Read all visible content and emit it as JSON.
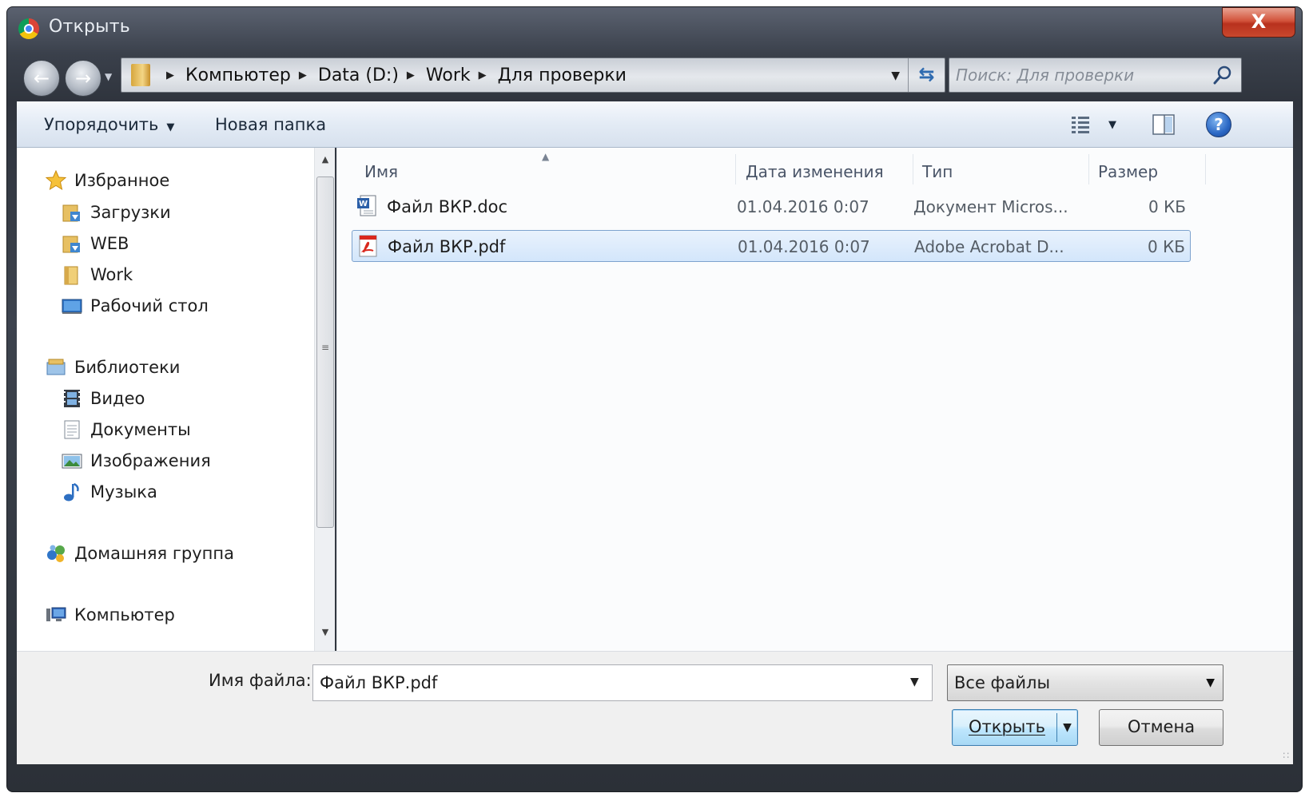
{
  "window": {
    "title": "Открыть",
    "close_glyph": "X"
  },
  "address": {
    "breadcrumb": [
      "Компьютер",
      "Data (D:)",
      "Work",
      "Для проверки"
    ],
    "search_placeholder": "Поиск: Для проверки"
  },
  "toolbar": {
    "organize_label": "Упорядочить",
    "new_folder_label": "Новая папка",
    "help_glyph": "?"
  },
  "nav": {
    "favorites": {
      "label": "Избранное",
      "items": [
        {
          "label": "Загрузки",
          "icon": "downloads-folder-icon"
        },
        {
          "label": "WEB",
          "icon": "downloads-folder-icon"
        },
        {
          "label": "Work",
          "icon": "folder-icon"
        },
        {
          "label": "Рабочий стол",
          "icon": "desktop-icon"
        }
      ]
    },
    "libraries": {
      "label": "Библиотеки",
      "items": [
        {
          "label": "Видео",
          "icon": "video-library-icon"
        },
        {
          "label": "Документы",
          "icon": "documents-library-icon"
        },
        {
          "label": "Изображения",
          "icon": "pictures-library-icon"
        },
        {
          "label": "Музыка",
          "icon": "music-library-icon"
        }
      ]
    },
    "homegroup": {
      "label": "Домашняя группа"
    },
    "computer": {
      "label": "Компьютер"
    }
  },
  "file_list": {
    "columns": [
      "Имя",
      "Дата изменения",
      "Тип",
      "Размер"
    ],
    "files": [
      {
        "name": "Файл ВКР.doc",
        "date": "01.04.2016 0:07",
        "type": "Документ Micros...",
        "size": "0 КБ",
        "icon": "word-document-icon",
        "selected": false
      },
      {
        "name": "Файл ВКР.pdf",
        "date": "01.04.2016 0:07",
        "type": "Adobe Acrobat D...",
        "size": "0 КБ",
        "icon": "pdf-document-icon",
        "selected": true
      }
    ]
  },
  "bottom": {
    "filename_label": "Имя файла:",
    "filename_value": "Файл ВКР.pdf",
    "filetype_value": "Все файлы",
    "open_label": "Открыть",
    "cancel_label": "Отмена"
  },
  "colors": {
    "selection": "#cce4fb",
    "selection_border": "#7da2ce",
    "toolbar_bg": "#e3ebf5",
    "frame_dark": "#2f343d"
  }
}
